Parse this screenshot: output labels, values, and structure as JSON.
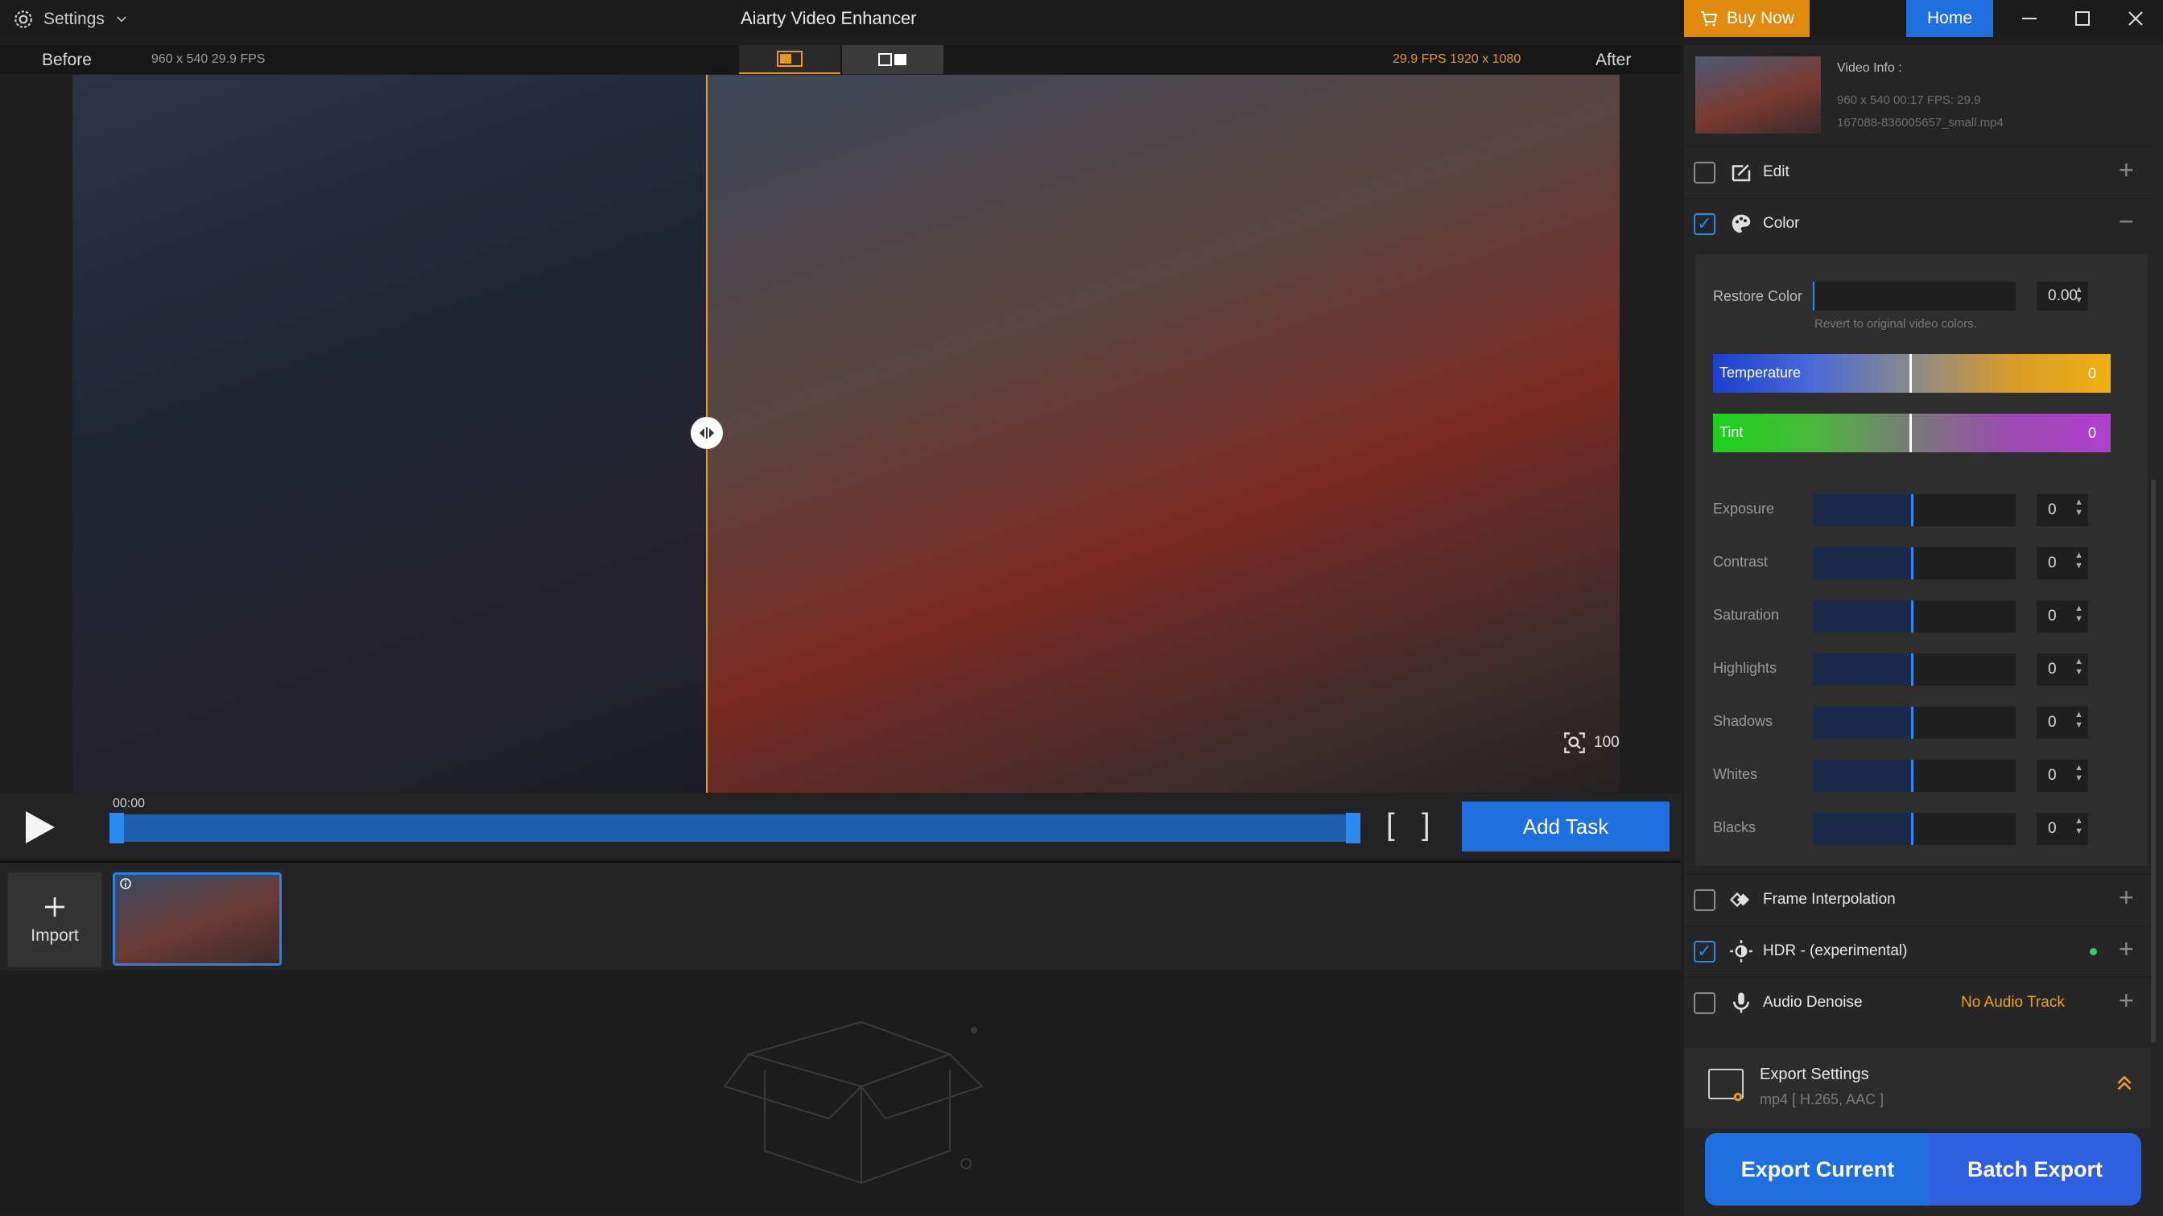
{
  "titlebar": {
    "settings_label": "Settings",
    "app_title": "Aiarty Video Enhancer",
    "buy_label": "Buy Now",
    "home_label": "Home",
    "accent_buy": "#e08b0e",
    "accent_home": "#1f6fe0"
  },
  "preview": {
    "before_label": "Before",
    "before_meta": "960 x 540  29.9 FPS",
    "after_label": "After",
    "after_meta": "29.9 FPS  1920 x 1080",
    "zoom_label": "100%"
  },
  "transport": {
    "time": "00:00",
    "bracket_in": "[",
    "bracket_out": "]",
    "add_task_label": "Add Task"
  },
  "clips": {
    "import_label": "Import"
  },
  "video_info": {
    "title": "Video Info :",
    "meta": "960 x 540  00:17    FPS: 29.9",
    "filename": "167088-836005657_small.mp4"
  },
  "sections": {
    "edit": "Edit",
    "color": "Color",
    "frame_interp": "Frame Interpolation",
    "hdr": "HDR - (experimental)",
    "audio": "Audio Denoise",
    "audio_warning": "No Audio Track"
  },
  "color": {
    "restore_label": "Restore Color",
    "restore_value": "0.00",
    "restore_hint": "Revert to original video colors.",
    "temperature_label": "Temperature",
    "temperature_value": "0",
    "tint_label": "Tint",
    "tint_value": "0",
    "adjustments": [
      {
        "label": "Exposure",
        "value": "0"
      },
      {
        "label": "Contrast",
        "value": "0"
      },
      {
        "label": "Saturation",
        "value": "0"
      },
      {
        "label": "Highlights",
        "value": "0"
      },
      {
        "label": "Shadows",
        "value": "0"
      },
      {
        "label": "Whites",
        "value": "0"
      },
      {
        "label": "Blacks",
        "value": "0"
      }
    ]
  },
  "export": {
    "settings_title": "Export Settings",
    "settings_sub": "mp4 [ H.265, AAC ]",
    "export_current": "Export Current",
    "batch_export": "Batch Export"
  }
}
